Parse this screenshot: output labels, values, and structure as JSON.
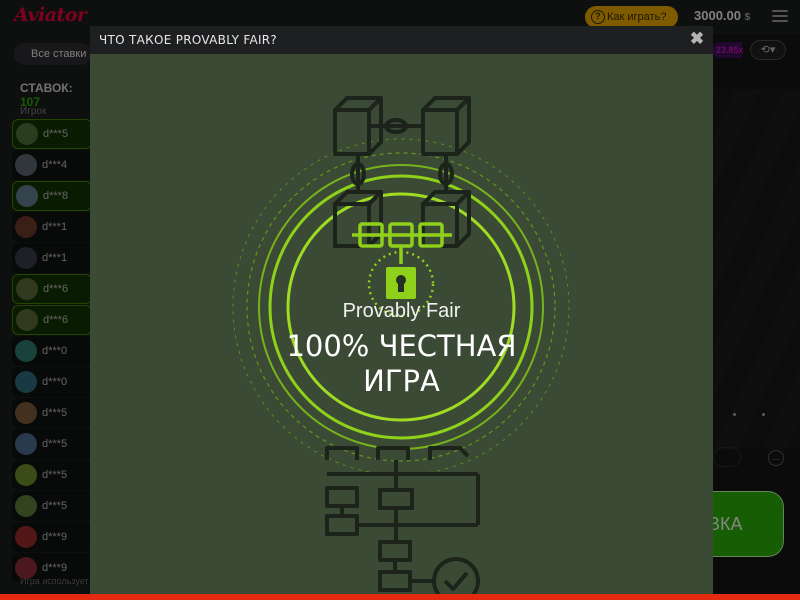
{
  "header": {
    "logo": "Aviator",
    "how_to_play": "Как играть?",
    "balance": "3000.00",
    "currency": "$",
    "icons": {
      "help": "question-circle-icon",
      "menu": "hamburger-menu-icon"
    }
  },
  "left_panel": {
    "all_bets_label": "Все ставки",
    "bets_label": "СТАВОК:",
    "bets_count": "107",
    "column_header": "Игрок",
    "rows": [
      {
        "name": "d***5",
        "win": true
      },
      {
        "name": "d***4",
        "win": false
      },
      {
        "name": "d***8",
        "win": true
      },
      {
        "name": "d***1",
        "win": false
      },
      {
        "name": "d***1",
        "win": false
      },
      {
        "name": "d***6",
        "win": true
      },
      {
        "name": "d***6",
        "win": true
      },
      {
        "name": "d***0",
        "win": false
      },
      {
        "name": "d***0",
        "win": false
      },
      {
        "name": "d***5",
        "win": false
      },
      {
        "name": "d***5",
        "win": false
      },
      {
        "name": "d***5",
        "win": false
      },
      {
        "name": "d***5",
        "win": false
      },
      {
        "name": "d***9",
        "win": false
      },
      {
        "name": "d***9",
        "win": false
      }
    ],
    "bottom_note": "Игра использует"
  },
  "game": {
    "multiplier_pill": "23.85x",
    "history_icon": "history-clock-icon",
    "bet_button_label": "ВКА"
  },
  "modal": {
    "title": "ЧТО ТАКОЕ PROVABLY FAIR?",
    "close_glyph": "✖",
    "subtitle": "Provably Fair",
    "headline_line1": "100% ЧЕСТНАЯ",
    "headline_line2": "ИГРА",
    "colors": {
      "background": "#3a4a34",
      "accent_green": "#8fd11a",
      "line_dark": "#1f2a1c"
    },
    "icons": [
      "block-chain-icon",
      "padlock-icon",
      "flowchart-icon",
      "checkmark-circle-icon"
    ]
  }
}
